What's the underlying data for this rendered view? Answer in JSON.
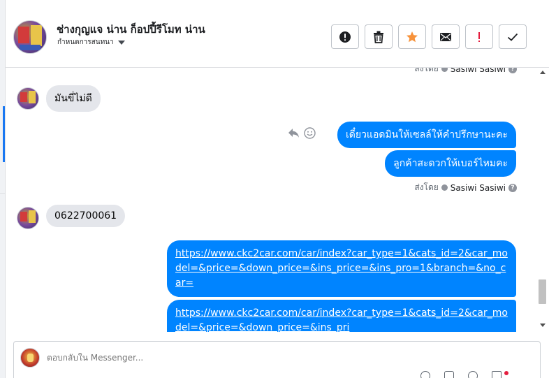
{
  "header": {
    "page_name": "ช่างกุญแจ น่าน ก็อปปี้รีโมท น่าน",
    "subtitle": "กำหนดการสนทนา",
    "actions": [
      {
        "name": "spam-button",
        "icon": "exclamation-circle-icon"
      },
      {
        "name": "delete-button",
        "icon": "trash-icon"
      },
      {
        "name": "star-button",
        "icon": "star-icon",
        "color": "#f7923a"
      },
      {
        "name": "mark-unread-button",
        "icon": "envelope-icon"
      },
      {
        "name": "follow-up-button",
        "icon": "exclamation-icon",
        "color": "#e41e3f"
      },
      {
        "name": "done-button",
        "icon": "check-icon"
      }
    ]
  },
  "messages": {
    "sent_by_label": "ส่งโดย",
    "sender_name": "Sasiwi Sasiwi",
    "help_glyph": "?",
    "in_1": "มันขี่ไม่ดี",
    "out_1": "เดี๋ยวแอดมินให้เซลล์ให้คำปรึกษานะคะ",
    "out_2": "ลูกค้าสะดวกให้เบอร์ไหมคะ",
    "in_2": "0622700061",
    "link_1": "https://www.ckc2car.com/car/index?car_type=1&cats_id=2&car_model=&price=&down_price=&ins_price=&ins_pro=1&branch=&no_car=",
    "link_2": "https://www.ckc2car.com/car/index?car_type=1&cats_id=2&car_model=&price=&down_price=&ins_pri"
  },
  "composer": {
    "placeholder": "ตอบกลับใน Messenger..."
  },
  "colors": {
    "accent": "#0084ff",
    "incoming_bubble": "#e4e6eb",
    "star": "#f7923a",
    "alert": "#e41e3f"
  }
}
